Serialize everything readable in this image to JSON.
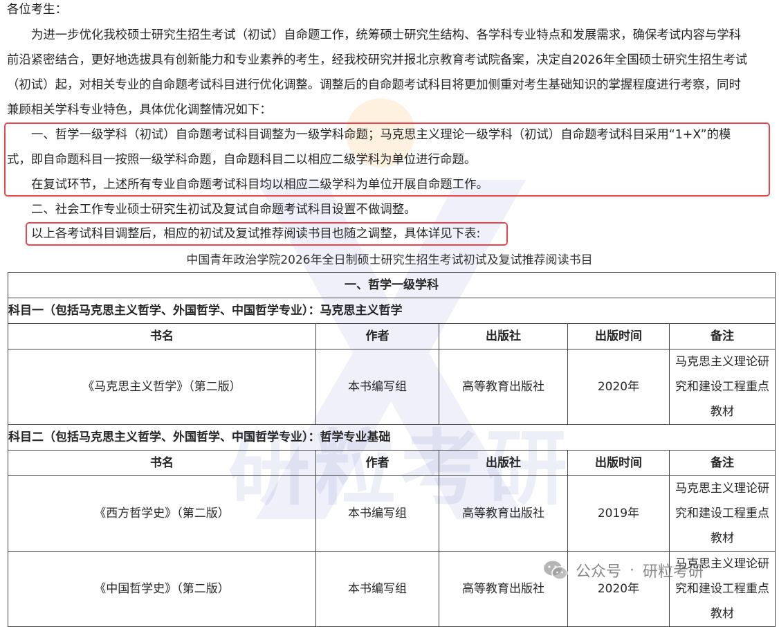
{
  "letter": {
    "greeting": "各位考生：",
    "intro": [
      "为进一步优化我校硕士研究生招生考试（初试）自命题工作，统筹硕士研究生结构、各学科专业特点和发展需求，确保考试内容与学科",
      "前沿紧密结合，更好地选拔具有创新能力和专业素养的考生，经我校研究并报北京教育考试院备案，决定自2026年全国硕士研究生招生考试",
      "（初试）起，对相关专业的自命题考试科目进行优化调整。调整后的自命题考试科目将更加侧重对考生基础知识的掌握程度进行考察，同时",
      "兼顾相关学科专业特色，具体优化调整情况如下："
    ],
    "point1": [
      "一、哲学一级学科（初试）自命题考试科目调整为一级学科命题；马克思主义理论一级学科（初试）自命题考试科目采用“1+X”的模",
      "式，即自命题科目一按照一级学科命题，自命题科目二以相应二级学科为单位进行命题。",
      "在复试环节，上述所有专业自命题考试科目均以相应二级学科为单位开展自命题工作。"
    ],
    "point2": "二、社会工作专业硕士研究生初试及复试自命题考试科目设置不做调整。",
    "closing": "以上各考试科目调整后，相应的初试及复试推荐阅读书目也随之调整，具体详见下表:"
  },
  "table": {
    "caption": "中国青年政治学院2026年全日制硕士研究生招生考试初试及复试推荐阅读书目",
    "section": "一、哲学一级学科",
    "headers": [
      "书名",
      "作者",
      "出版社",
      "出版时间",
      "备注"
    ],
    "subjects": [
      {
        "title": "科目一（包括马克思主义哲学、外国哲学、中国哲学专业）：马克思主义哲学",
        "rows": [
          {
            "book": "《马克思主义哲学》（第二版）",
            "author": "本书编写组",
            "publisher": "高等教育出版社",
            "year": "2020年",
            "note": "马克思主义理论研究和建设工程重点教材"
          }
        ]
      },
      {
        "title": "科目二（包括马克思主义哲学、外国哲学、中国哲学专业）：哲学专业基础",
        "rows": [
          {
            "book": "《西方哲学史》（第二版）",
            "author": "本书编写组",
            "publisher": "高等教育出版社",
            "year": "2019年",
            "note": "马克思主义理论研究和建设工程重点教材"
          },
          {
            "book": "《中国哲学史》（第二版）",
            "author": "本书编写组",
            "publisher": "高等教育出版社",
            "year": "2020年",
            "note": "马克思主义理论研究和建设工程重点教材"
          }
        ]
      }
    ]
  },
  "watermark": {
    "text": "研粒考研",
    "footer_prefix": "公众号",
    "footer_separator": "·",
    "footer_name": "研粒考研",
    "colors": {
      "x_blue": "#7c8bd6",
      "sun_orange": "#ffa83a"
    }
  },
  "colors": {
    "highlight_border": "#e8464a",
    "text": "#262626"
  }
}
